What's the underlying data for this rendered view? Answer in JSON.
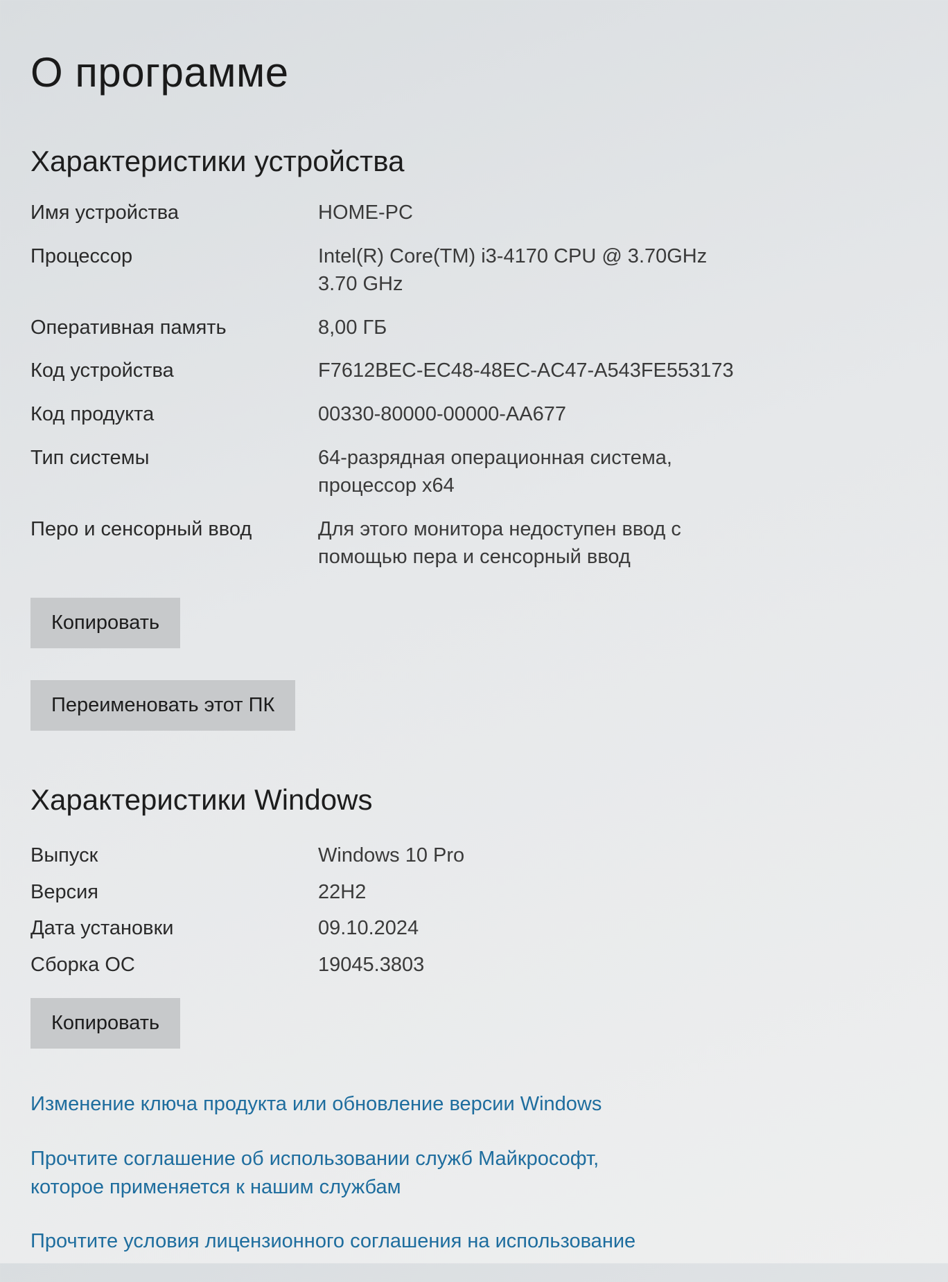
{
  "page": {
    "title": "О программе"
  },
  "device_specs": {
    "heading": "Характеристики устройства",
    "rows": [
      {
        "label": "Имя устройства",
        "value": "HOME-PC"
      },
      {
        "label": "Процессор",
        "value": "Intel(R) Core(TM) i3-4170 CPU @ 3.70GHz 3.70 GHz"
      },
      {
        "label": "Оперативная память",
        "value": "8,00 ГБ"
      },
      {
        "label": "Код устройства",
        "value": "F7612BEC-EC48-48EC-AC47-A543FE553173"
      },
      {
        "label": "Код продукта",
        "value": "00330-80000-00000-AA677"
      },
      {
        "label": "Тип системы",
        "value": "64-разрядная операционная система, процессор x64"
      },
      {
        "label": "Перо и сенсорный ввод",
        "value": "Для этого монитора недоступен ввод с помощью пера и сенсорный ввод"
      }
    ],
    "copy_button": "Копировать",
    "rename_button": "Переименовать этот ПК"
  },
  "windows_specs": {
    "heading": "Характеристики Windows",
    "rows": [
      {
        "label": "Выпуск",
        "value": "Windows 10 Pro"
      },
      {
        "label": "Версия",
        "value": "22H2"
      },
      {
        "label": "Дата установки",
        "value": "09.10.2024"
      },
      {
        "label": "Сборка ОС",
        "value": "19045.3803"
      }
    ],
    "copy_button": "Копировать"
  },
  "links": [
    "Изменение ключа продукта или обновление версии Windows",
    "Прочтите соглашение об использовании служб Майкрософт, которое применяется к нашим службам",
    "Прочтите условия лицензионного соглашения на использование"
  ]
}
